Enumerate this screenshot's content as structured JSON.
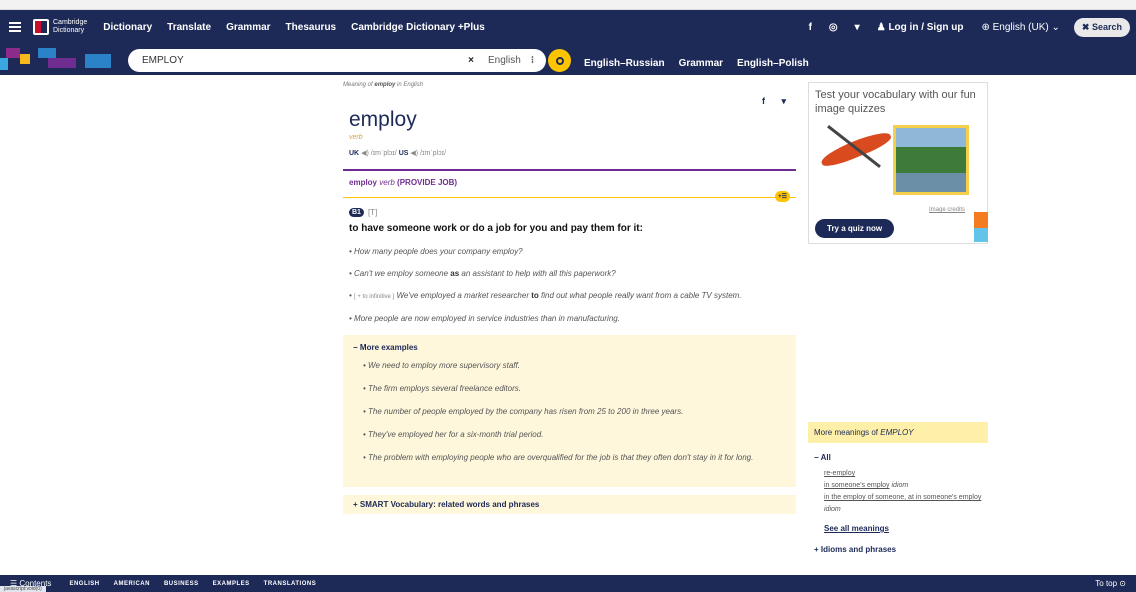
{
  "nav": {
    "site_name_line1": "Cambridge",
    "site_name_line2": "Dictionary",
    "links": [
      "Dictionary",
      "Translate",
      "Grammar",
      "Thesaurus",
      "Cambridge Dictionary +Plus"
    ],
    "social": [
      "f",
      "◎",
      "▾"
    ],
    "login": "Log in / Sign up",
    "language": "English (UK)",
    "search_btn": "Search"
  },
  "search": {
    "query": "EMPLOY",
    "clear": "×",
    "dict_label": "English",
    "dict_dropdown": "⁝"
  },
  "quicklinks": [
    "English–Russian",
    "Grammar",
    "English–Polish"
  ],
  "entry": {
    "meaning_prefix": "Meaning of",
    "meaning_word": "employ",
    "meaning_suffix": "in English",
    "share": [
      "f",
      "▾"
    ],
    "headword": "employ",
    "pos": "verb",
    "uk_label": "UK",
    "uk_ipa": "/ɪmˈplɔɪ/",
    "us_label": "US",
    "us_ipa": "/ɪmˈplɔɪ/",
    "guide_word": "employ",
    "guide_pos": "verb",
    "guide_sense": "(PROVIDE JOB)",
    "plus_list": "+☰",
    "level": "B1",
    "grammar": "[T]",
    "definition": "to have someone work or do a job for you and pay them for it:",
    "examples": [
      {
        "pre": "How many people does your company employ?",
        "bold": "",
        "post": "",
        "gram": ""
      },
      {
        "pre": "Can't we employ someone ",
        "bold": "as",
        "post": " an assistant to help with all this paperwork?",
        "gram": ""
      },
      {
        "pre": " We've employed a market researcher ",
        "bold": "to",
        "post": " find out what people really want from a cable TV system.",
        "gram": "[ + to infinitive ]"
      },
      {
        "pre": "More people are now employed in service industries than in manufacturing.",
        "bold": "",
        "post": "",
        "gram": ""
      }
    ],
    "more_examples_title": "More examples",
    "more_examples": [
      "We need to employ more supervisory staff.",
      "The firm employs several freelance editors.",
      "The number of people employed by the company has risen from 25 to 200 in three years.",
      "They've employed her for a six-month trial period.",
      "The problem with employing people who are overqualified for the job is that they often don't stay in it for long."
    ],
    "smart_vocab": "SMART Vocabulary: related words and phrases"
  },
  "quiz": {
    "title": "Test your vocabulary with our fun image quizzes",
    "credits": "Image credits",
    "button": "Try a quiz now"
  },
  "more_meanings": {
    "header_prefix": "More meanings of",
    "header_word": "EMPLOY",
    "all_label": "All",
    "links": [
      {
        "text": "re-employ",
        "suffix": ""
      },
      {
        "text": "in someone's employ",
        "suffix": " idiom"
      },
      {
        "text": "in the employ of someone, at in someone's employ",
        "suffix": " idiom"
      }
    ],
    "see_all": "See all meanings",
    "idioms": "Idioms and phrases"
  },
  "bottom": {
    "contents": "Contents",
    "tabs": [
      "ENGLISH",
      "AMERICAN",
      "BUSINESS",
      "EXAMPLES",
      "TRANSLATIONS"
    ],
    "to_top": "To top"
  },
  "status_url": "javascript:void(0)"
}
